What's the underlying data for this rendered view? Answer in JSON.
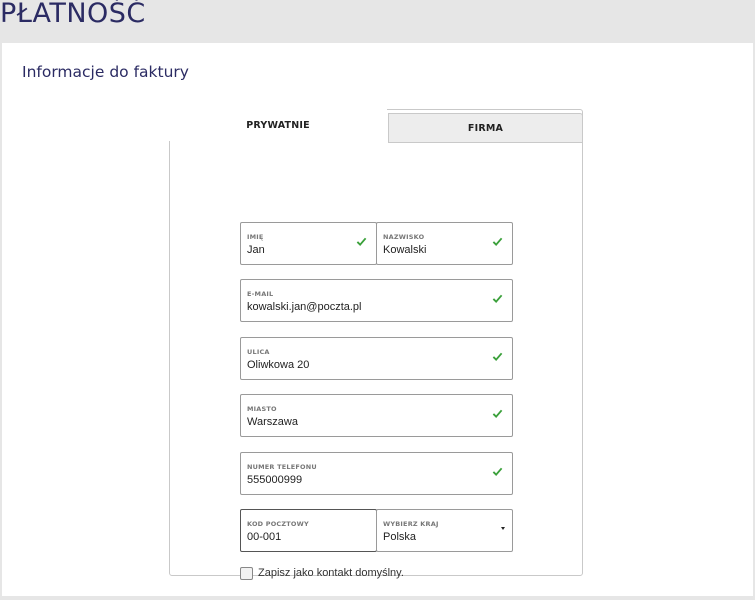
{
  "page": {
    "title": "PŁATNOŚĆ"
  },
  "invoice": {
    "title": "Informacje do faktury",
    "tabs": [
      {
        "label": "PRYWATNIE",
        "active": true
      },
      {
        "label": "FIRMA",
        "active": false
      }
    ],
    "fields": {
      "first_name": {
        "label": "IMIĘ",
        "value": "Jan",
        "valid": true
      },
      "last_name": {
        "label": "NAZWISKO",
        "value": "Kowalski",
        "valid": true
      },
      "email": {
        "label": "E-MAIL",
        "value": "kowalski.jan@poczta.pl",
        "valid": true
      },
      "street": {
        "label": "ULICA",
        "value": "Oliwkowa 20",
        "valid": true
      },
      "city": {
        "label": "MIASTO",
        "value": "Warszawa",
        "valid": true
      },
      "phone": {
        "label": "NUMER TELEFONU",
        "value": "555000999",
        "valid": true
      },
      "postal_code": {
        "label": "KOD POCZTOWY",
        "value": "00-001"
      },
      "country": {
        "label": "WYBIERZ KRAJ",
        "value": "Polska"
      }
    },
    "save_default": {
      "label": "Zapisz jako kontakt domyślny.",
      "checked": false
    }
  },
  "colors": {
    "accent": "#2b2b63",
    "valid": "#3aa03a",
    "background": "#e6e6e6"
  },
  "icons": {
    "valid": "checkmark-icon",
    "dropdown": "caret-down-icon"
  }
}
